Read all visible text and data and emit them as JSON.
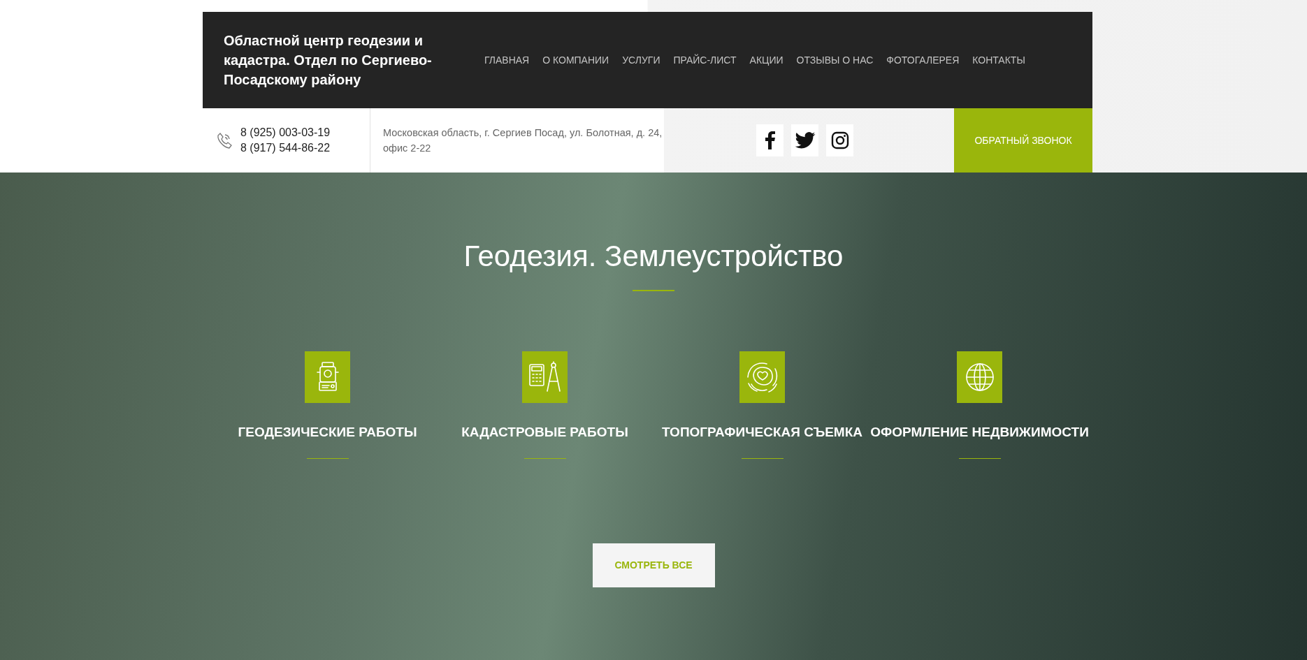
{
  "header": {
    "title": "Областной центр геодезии и кадастра. Отдел по Сергиево-Посадскому району",
    "nav": [
      "ГЛАВНАЯ",
      "О КОМПАНИИ",
      "УСЛУГИ",
      "ПРАЙС-ЛИСТ",
      "АКЦИИ",
      "ОТЗЫВЫ О НАС",
      "ФОТОГАЛЕРЕЯ",
      "КОНТАКТЫ"
    ]
  },
  "contacts": {
    "phones": [
      "8 (925) 003-03-19",
      "8 (917) 544-86-22"
    ],
    "address": "Московская область, г. Сергиев Посад, ул. Болотная, д. 24, офис 2-22",
    "social": [
      {
        "kind": "facebook"
      },
      {
        "kind": "twitter"
      },
      {
        "kind": "instagram"
      }
    ],
    "callback_button": "ОБРАТНЫЙ ЗВОНОК"
  },
  "hero": {
    "title": "Геодезия. Землеустройство",
    "services": [
      {
        "kind": "instrument",
        "label": "ГЕОДЕЗИЧЕСКИЕ РАБОТЫ"
      },
      {
        "kind": "calculator",
        "label": "КАДАСТРОВЫЕ РАБОТЫ"
      },
      {
        "kind": "contour",
        "label": "ТОПОГРАФИЧЕСКАЯ СЪЕМКА"
      },
      {
        "kind": "globe",
        "label": "ОФОРМЛЕНИЕ НЕДВИЖИМОСТИ"
      }
    ],
    "button": "СМОТРЕТЬ ВСЕ"
  }
}
